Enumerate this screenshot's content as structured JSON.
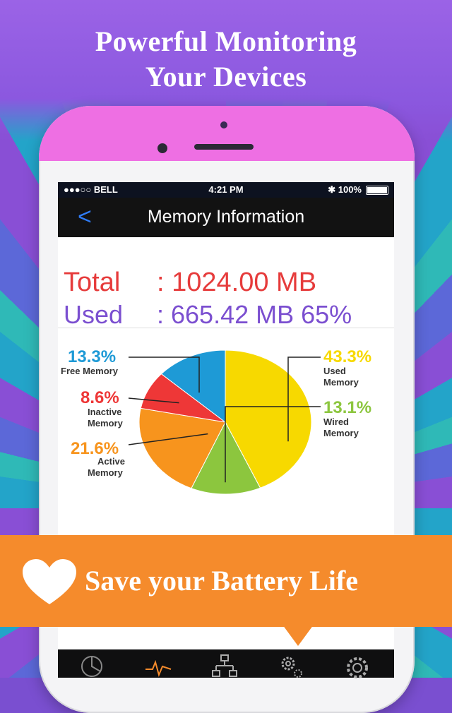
{
  "promo": {
    "headline_line1": "Powerful Monitoring",
    "headline_line2": "Your Devices",
    "banner_text": "Save your Battery Life",
    "banner_color": "#f58b2c"
  },
  "status_bar": {
    "carrier": "●●●○○ BELL",
    "time": "4:21 PM",
    "battery": "✱ 100%"
  },
  "nav": {
    "back": "<",
    "title": "Memory Information"
  },
  "summary": {
    "total_label": "Total",
    "total_value": ": 1024.00 MB",
    "used_label": "Used",
    "used_value": ": 665.42 MB 65%"
  },
  "chart_data": {
    "type": "pie",
    "slices": [
      {
        "label": "Used Memory",
        "percent": 43.3,
        "percent_text": "43.3%",
        "caption": [
          "Used",
          "Memory"
        ],
        "color": "#f7d900"
      },
      {
        "label": "Wired Memory",
        "percent": 13.1,
        "percent_text": "13.1%",
        "caption": [
          "Wired",
          "Memory"
        ],
        "color": "#8cc63e"
      },
      {
        "label": "Active Memory",
        "percent": 21.6,
        "percent_text": "21.6%",
        "caption": [
          "Active",
          "Memory"
        ],
        "color": "#f7941d"
      },
      {
        "label": "Inactive Memory",
        "percent": 8.6,
        "percent_text": "8.6%",
        "caption": [
          "Inactive",
          "Memory"
        ],
        "color": "#ee3737"
      },
      {
        "label": "Free Memory",
        "percent": 13.3,
        "percent_text": "13.3%",
        "caption": [
          "Free Memory"
        ],
        "color": "#1e9ad6"
      }
    ]
  },
  "tab_bar": {
    "tabs": [
      {
        "name": "pie-chart-icon",
        "active": false
      },
      {
        "name": "pulse-icon",
        "active": true
      },
      {
        "name": "network-icon",
        "active": false
      },
      {
        "name": "gears-icon",
        "active": false
      },
      {
        "name": "settings-icon",
        "active": false
      }
    ]
  }
}
